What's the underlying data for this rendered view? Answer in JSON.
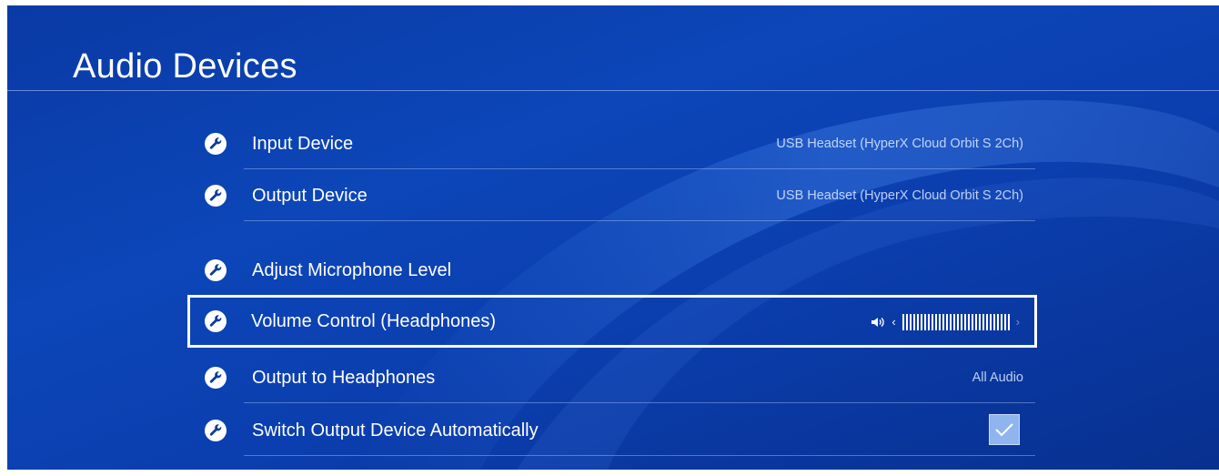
{
  "header": {
    "title": "Audio Devices"
  },
  "settings": [
    {
      "label": "Input Device",
      "value": "USB Headset (HyperX Cloud Orbit S 2Ch)",
      "icon": "wrench-icon"
    },
    {
      "label": "Output Device",
      "value": "USB Headset (HyperX Cloud Orbit S 2Ch)",
      "icon": "wrench-icon"
    },
    {
      "label": "Adjust Microphone Level",
      "icon": "wrench-icon"
    },
    {
      "label": "Volume Control (Headphones)",
      "icon": "wrench-icon",
      "volume_level": 1.0,
      "volume_icon": "speaker-icon",
      "focused": true
    },
    {
      "label": "Output to Headphones",
      "value": "All Audio",
      "icon": "wrench-icon"
    },
    {
      "label": "Switch Output Device Automatically",
      "icon": "wrench-icon",
      "checked": true
    }
  ],
  "colors": {
    "background": "#0b40b0",
    "text": "#ffffff",
    "focus_border": "#ffffff",
    "checkbox_fill": "#8fb4ee"
  }
}
